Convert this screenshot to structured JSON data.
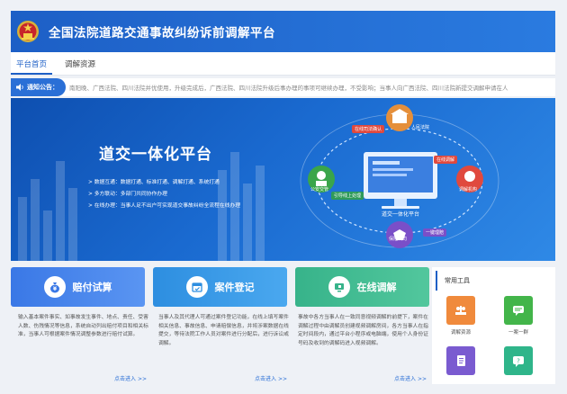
{
  "header": {
    "title": "全国法院道路交通事故纠纷诉前调解平台"
  },
  "nav": {
    "tabs": [
      {
        "label": "平台首页"
      },
      {
        "label": "调解资源"
      }
    ]
  },
  "notice": {
    "tag": "通知公告：",
    "text": "南阳晚、广西法院、四川法院并优使用，升级完成后，广西法院、四川法院升级后事办理的事项可继续办理，不受影响；当事人向广西法院、四川法院新提交调解申请在人"
  },
  "banner": {
    "title": "道交一体化平台",
    "bullets": [
      "数据互通：数据打通、标准打通、调解打通、系统打通",
      "多方联动：多部门共同协作办理",
      "在线办理：当事人足不出户可实现道交事故纠纷全流程在线办理"
    ],
    "center_label": "道交一体化平台",
    "nodes": {
      "court": "人民法院",
      "online_confirm": "在线司法确认",
      "mediation": "调解机构",
      "online_mediate": "在线调解",
      "police": "公安交管",
      "guide": "引导线上处理",
      "insurance": "保险公司",
      "claim": "一键理赔"
    }
  },
  "cards": [
    {
      "title": "赔付试算",
      "desc": "输入基本案件事实、如事故发生事件、地点、责任、受害人数、伤残情况等信息，系统自动列出赔付项目和相关标准，当事人可根据案件情况调整参数进行赔付试算。",
      "enter": "点击进入 >>"
    },
    {
      "title": "案件登记",
      "desc": "当事人及其代理人可通过案件登记功能，在线上填写案件相关信息、事故信息、申请赔偿信息，并将涉案数据在线提交，等待法院工作人员对案件进行分配后，进行诉讼或调解。",
      "enter": "点击进入 >>"
    },
    {
      "title": "在线调解",
      "desc": "事故中各方当事人在一致同意视频调解的前提下，案件在调解过程中由调解员创建视频调解房间，各方当事人在指定时间段内，通过平台小程序或电脑端，使用个人身份证号码及收到的调解码进入视频调解。",
      "enter": "点击进入 >>"
    }
  ],
  "tools": {
    "title": "常用工具",
    "items": [
      {
        "label": "调解资源",
        "color": "#f08a3c"
      },
      {
        "label": "一案一群",
        "color": "#43b54a"
      },
      {
        "label": "",
        "color": "#7a5bd0"
      },
      {
        "label": "",
        "color": "#2fb58a"
      }
    ]
  },
  "colors": {
    "primary": "#1d5fc6",
    "notice": "#2a6fd6"
  }
}
